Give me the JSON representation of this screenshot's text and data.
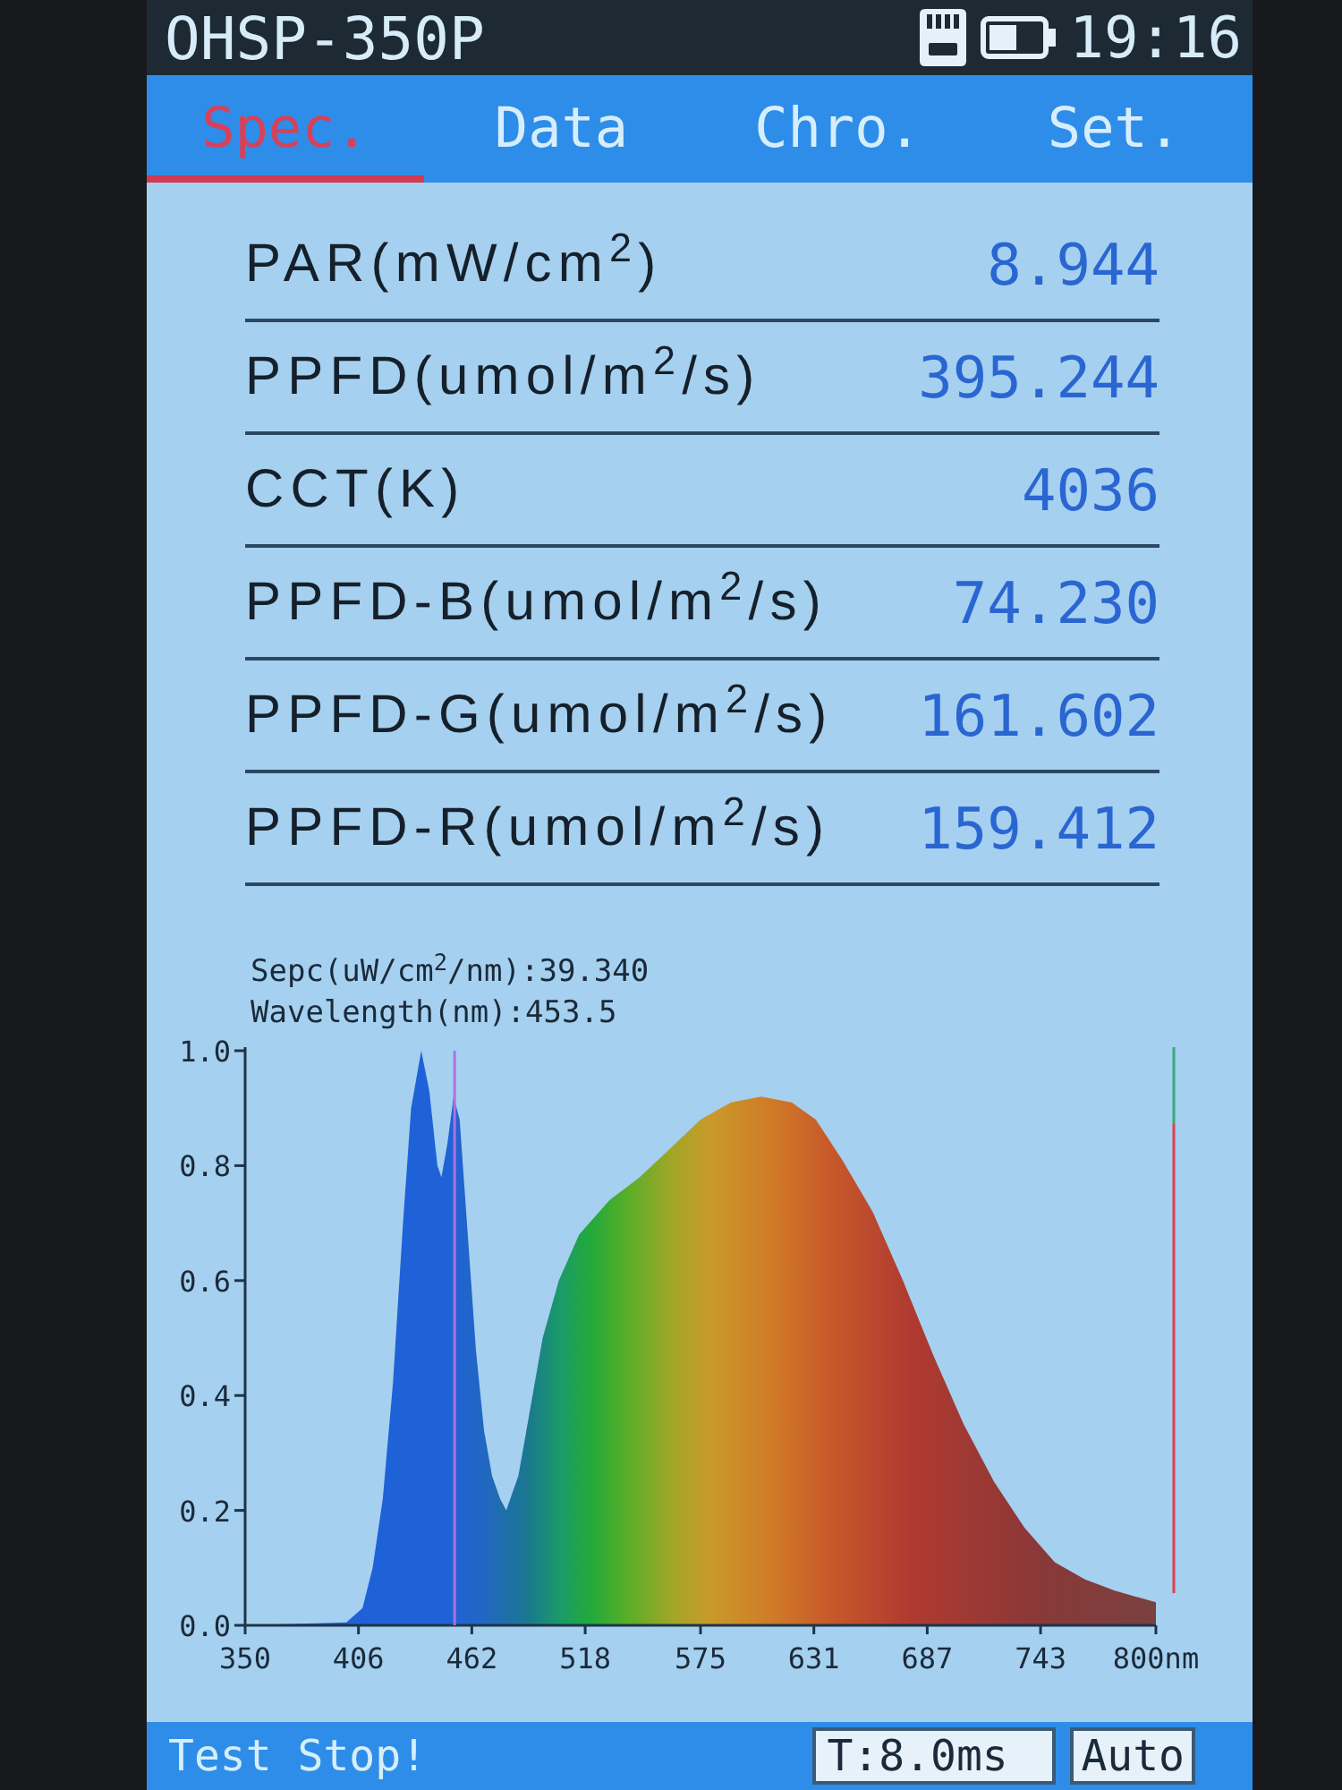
{
  "top_bar": {
    "title": "OHSP-350P",
    "time": "19:16"
  },
  "tabs": [
    {
      "label": "Spec.",
      "selected": true
    },
    {
      "label": "Data",
      "selected": false
    },
    {
      "label": "Chro.",
      "selected": false
    },
    {
      "label": "Set.",
      "selected": false
    }
  ],
  "measurements": [
    {
      "label": "PAR(mW/cm$^{2}$)",
      "value": "8.944"
    },
    {
      "label": "PPFD(umol/m$^{2}$/s)",
      "value": "395.244"
    },
    {
      "label": "CCT(K)",
      "value": "4036"
    },
    {
      "label": "PPFD-B(umol/m$^{2}$/s)",
      "value": "74.230"
    },
    {
      "label": "PPFD-G(umol/m$^{2}$/s)",
      "value": "161.602"
    },
    {
      "label": "PPFD-R(umol/m$^{2}$/s)",
      "value": "159.412"
    }
  ],
  "spectrum": {
    "readouts": [
      "Sepc(uW/cm$^{2}$/nm):39.340",
      "Wavelength(nm):453.5"
    ],
    "chart_data": {
      "type": "area",
      "x": [
        350,
        400,
        408,
        413,
        418,
        423,
        428,
        432,
        437,
        441,
        445,
        447,
        450,
        453,
        456,
        460,
        464,
        468,
        472,
        476,
        479,
        485,
        490,
        497,
        505,
        515,
        530,
        545,
        560,
        575,
        590,
        605,
        620,
        632,
        645,
        660,
        675,
        690,
        705,
        720,
        735,
        750,
        765,
        780,
        790,
        800
      ],
      "values": [
        0,
        0.005,
        0.03,
        0.1,
        0.22,
        0.42,
        0.7,
        0.9,
        1.0,
        0.93,
        0.8,
        0.78,
        0.84,
        0.92,
        0.88,
        0.68,
        0.48,
        0.34,
        0.26,
        0.22,
        0.2,
        0.26,
        0.36,
        0.5,
        0.6,
        0.68,
        0.74,
        0.78,
        0.83,
        0.88,
        0.91,
        0.92,
        0.91,
        0.88,
        0.81,
        0.72,
        0.6,
        0.47,
        0.35,
        0.25,
        0.17,
        0.11,
        0.08,
        0.06,
        0.05,
        0.04
      ],
      "xlim": [
        350,
        800
      ],
      "ylim": [
        0,
        1
      ],
      "xticks": [
        350,
        406,
        462,
        518,
        575,
        631,
        687,
        743,
        {
          "value": 800,
          "label": "800nm"
        }
      ],
      "yticks": [
        {
          "value": 0,
          "label": "0.0"
        },
        {
          "value": 0.2,
          "label": "0.2"
        },
        {
          "value": 0.4,
          "label": "0.4"
        },
        {
          "value": 0.6,
          "label": "0.6"
        },
        {
          "value": 0.8,
          "label": "0.8"
        },
        {
          "value": 1,
          "label": "1.0"
        }
      ],
      "ref_lines": [
        {
          "axis": "x",
          "value": 453.5
        }
      ]
    }
  },
  "status_bar": {
    "message": "Test Stop!",
    "integration_time": "T:8.0ms",
    "mode": "Auto"
  }
}
